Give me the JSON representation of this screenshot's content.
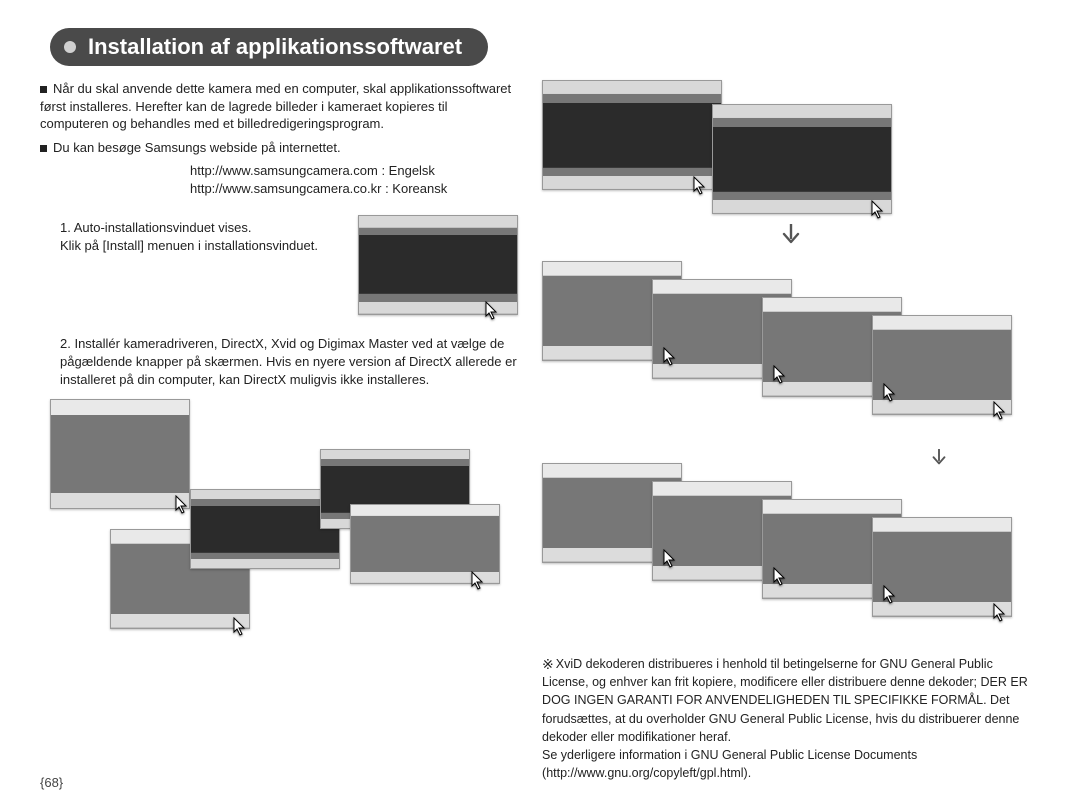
{
  "title": "Installation af applikationssoftwaret",
  "intro1": "Når du skal anvende dette kamera med en computer, skal applikationssoftwaret først installeres. Herefter kan de lagrede billeder i kameraet kopieres til computeren og behandles med et billedredigeringsprogram.",
  "intro2": "Du kan besøge Samsungs webside på internettet.",
  "link1": "http://www.samsungcamera.com : Engelsk",
  "link2": "http://www.samsungcamera.co.kr : Koreansk",
  "step1": "1. Auto-installationsvinduet vises.\n   Klik på [Install] menuen i installationsvinduet.",
  "step2": "2. Installér kameradriveren, DirectX, Xvid og Digimax Master ved at vælge de pågældende knapper på skærmen. Hvis en nyere version af DirectX allerede er installeret på din computer, kan DirectX muligvis ikke installeres.",
  "xvid_note": "XviD dekoderen distribueres i henhold til betingelserne for GNU General Public License, og enhver kan frit kopiere, modificere eller distribuere denne dekoder; DER ER DOG INGEN GARANTI FOR ANVENDELIGHEDEN TIL SPECIFIKKE FORMÅL. Det forudsættes, at du overholder GNU General Public License, hvis du distribuerer denne dekoder eller modifikationer heraf.\nSe yderligere information i GNU General Public License Documents (http://www.gnu.org/copyleft/gpl.html).",
  "page_number": "{68}"
}
